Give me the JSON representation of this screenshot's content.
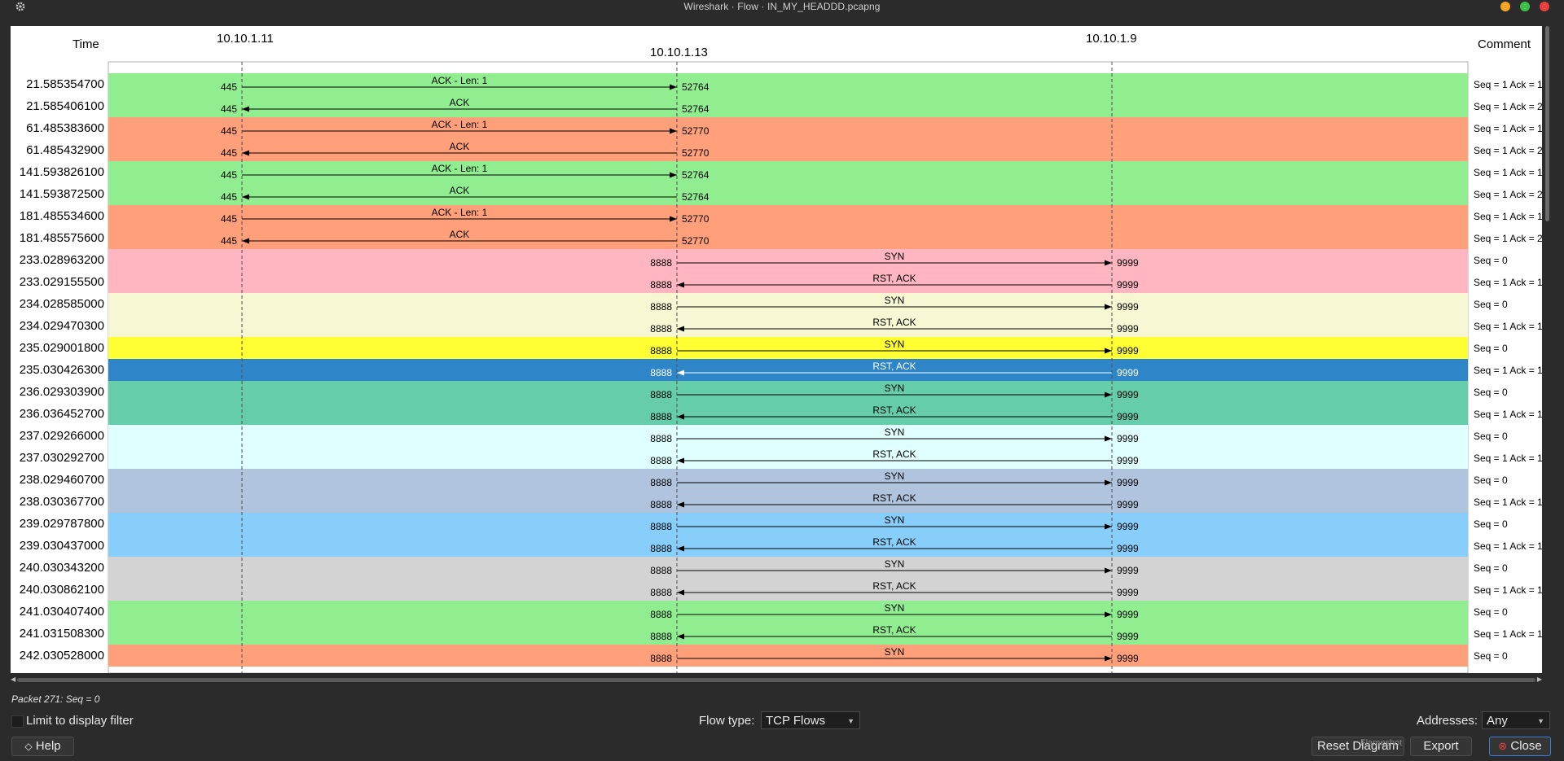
{
  "window": {
    "title": "Wireshark · Flow · IN_MY_HEADDD.pcapng",
    "settings_icon": "gear-icon",
    "buttons": [
      {
        "name": "minimize-button",
        "color": "#f5a623"
      },
      {
        "name": "maximize-button",
        "color": "#3fbf4a"
      },
      {
        "name": "close-window-button",
        "color": "#e8423f"
      }
    ]
  },
  "flow": {
    "headers": {
      "time": "Time",
      "comment": "Comment"
    },
    "hosts": [
      "10.10.1.11",
      "10.10.1.13",
      "10.10.1.9"
    ],
    "rows": [
      {
        "time": "21.585354700",
        "from": 0,
        "to": 1,
        "label": "ACK - Len: 1",
        "src_port": "445",
        "dst_port": "52764",
        "comment": "Seq = 1 Ack = 1",
        "bg": "#90ee90"
      },
      {
        "time": "21.585406100",
        "from": 1,
        "to": 0,
        "label": "ACK",
        "src_port": "52764",
        "dst_port": "445",
        "comment": "Seq = 1 Ack = 2",
        "bg": "#90ee90"
      },
      {
        "time": "61.485383600",
        "from": 0,
        "to": 1,
        "label": "ACK - Len: 1",
        "src_port": "445",
        "dst_port": "52770",
        "comment": "Seq = 1 Ack = 1",
        "bg": "#ffa07a"
      },
      {
        "time": "61.485432900",
        "from": 1,
        "to": 0,
        "label": "ACK",
        "src_port": "52770",
        "dst_port": "445",
        "comment": "Seq = 1 Ack = 2",
        "bg": "#ffa07a"
      },
      {
        "time": "141.593826100",
        "from": 0,
        "to": 1,
        "label": "ACK - Len: 1",
        "src_port": "445",
        "dst_port": "52764",
        "comment": "Seq = 1 Ack = 1",
        "bg": "#90ee90"
      },
      {
        "time": "141.593872500",
        "from": 1,
        "to": 0,
        "label": "ACK",
        "src_port": "52764",
        "dst_port": "445",
        "comment": "Seq = 1 Ack = 2",
        "bg": "#90ee90"
      },
      {
        "time": "181.485534600",
        "from": 0,
        "to": 1,
        "label": "ACK - Len: 1",
        "src_port": "445",
        "dst_port": "52770",
        "comment": "Seq = 1 Ack = 1",
        "bg": "#ffa07a"
      },
      {
        "time": "181.485575600",
        "from": 1,
        "to": 0,
        "label": "ACK",
        "src_port": "52770",
        "dst_port": "445",
        "comment": "Seq = 1 Ack = 2",
        "bg": "#ffa07a"
      },
      {
        "time": "233.028963200",
        "from": 1,
        "to": 2,
        "label": "SYN",
        "src_port": "8888",
        "dst_port": "9999",
        "comment": "Seq = 0",
        "bg": "#ffb6c1"
      },
      {
        "time": "233.029155500",
        "from": 2,
        "to": 1,
        "label": "RST, ACK",
        "src_port": "9999",
        "dst_port": "8888",
        "comment": "Seq = 1 Ack = 1",
        "bg": "#ffb6c1"
      },
      {
        "time": "234.028585000",
        "from": 1,
        "to": 2,
        "label": "SYN",
        "src_port": "8888",
        "dst_port": "9999",
        "comment": "Seq = 0",
        "bg": "#f7f7d3"
      },
      {
        "time": "234.029470300",
        "from": 2,
        "to": 1,
        "label": "RST, ACK",
        "src_port": "9999",
        "dst_port": "8888",
        "comment": "Seq = 1 Ack = 1",
        "bg": "#f7f7d3"
      },
      {
        "time": "235.029001800",
        "from": 1,
        "to": 2,
        "label": "SYN",
        "src_port": "8888",
        "dst_port": "9999",
        "comment": "Seq = 0",
        "bg": "#ffff33"
      },
      {
        "time": "235.030426300",
        "from": 2,
        "to": 1,
        "label": "RST, ACK",
        "src_port": "9999",
        "dst_port": "8888",
        "comment": "Seq = 1 Ack = 1",
        "bg": "#2e86c9",
        "selected": true
      },
      {
        "time": "236.029303900",
        "from": 1,
        "to": 2,
        "label": "SYN",
        "src_port": "8888",
        "dst_port": "9999",
        "comment": "Seq = 0",
        "bg": "#66cdaa"
      },
      {
        "time": "236.036452700",
        "from": 2,
        "to": 1,
        "label": "RST, ACK",
        "src_port": "9999",
        "dst_port": "8888",
        "comment": "Seq = 1 Ack = 1",
        "bg": "#66cdaa"
      },
      {
        "time": "237.029266000",
        "from": 1,
        "to": 2,
        "label": "SYN",
        "src_port": "8888",
        "dst_port": "9999",
        "comment": "Seq = 0",
        "bg": "#e0ffff"
      },
      {
        "time": "237.030292700",
        "from": 2,
        "to": 1,
        "label": "RST, ACK",
        "src_port": "9999",
        "dst_port": "8888",
        "comment": "Seq = 1 Ack = 1",
        "bg": "#e0ffff"
      },
      {
        "time": "238.029460700",
        "from": 1,
        "to": 2,
        "label": "SYN",
        "src_port": "8888",
        "dst_port": "9999",
        "comment": "Seq = 0",
        "bg": "#b0c4de"
      },
      {
        "time": "238.030367700",
        "from": 2,
        "to": 1,
        "label": "RST, ACK",
        "src_port": "9999",
        "dst_port": "8888",
        "comment": "Seq = 1 Ack = 1",
        "bg": "#b0c4de"
      },
      {
        "time": "239.029787800",
        "from": 1,
        "to": 2,
        "label": "SYN",
        "src_port": "8888",
        "dst_port": "9999",
        "comment": "Seq = 0",
        "bg": "#87cefa"
      },
      {
        "time": "239.030437000",
        "from": 2,
        "to": 1,
        "label": "RST, ACK",
        "src_port": "9999",
        "dst_port": "8888",
        "comment": "Seq = 1 Ack = 1",
        "bg": "#87cefa"
      },
      {
        "time": "240.030343200",
        "from": 1,
        "to": 2,
        "label": "SYN",
        "src_port": "8888",
        "dst_port": "9999",
        "comment": "Seq = 0",
        "bg": "#d3d3d3"
      },
      {
        "time": "240.030862100",
        "from": 2,
        "to": 1,
        "label": "RST, ACK",
        "src_port": "9999",
        "dst_port": "8888",
        "comment": "Seq = 1 Ack = 1",
        "bg": "#d3d3d3"
      },
      {
        "time": "241.030407400",
        "from": 1,
        "to": 2,
        "label": "SYN",
        "src_port": "8888",
        "dst_port": "9999",
        "comment": "Seq = 0",
        "bg": "#90ee90"
      },
      {
        "time": "241.031508300",
        "from": 2,
        "to": 1,
        "label": "RST, ACK",
        "src_port": "9999",
        "dst_port": "8888",
        "comment": "Seq = 1 Ack = 1",
        "bg": "#90ee90"
      },
      {
        "time": "242.030528000",
        "from": 1,
        "to": 2,
        "label": "SYN",
        "src_port": "8888",
        "dst_port": "9999",
        "comment": "Seq = 0",
        "bg": "#ffa07a"
      }
    ]
  },
  "status": {
    "text": "Packet 271: Seq = 0"
  },
  "controls": {
    "limit_label": "Limit to display filter",
    "flow_type_label": "Flow type:",
    "flow_type_value": "TCP Flows",
    "addresses_label": "Addresses:",
    "addresses_value": "Any"
  },
  "buttons": {
    "help": "Help",
    "reset": "Reset Diagram",
    "reset_tooltip": "Flameshot",
    "export": "Export",
    "close": "Close"
  }
}
